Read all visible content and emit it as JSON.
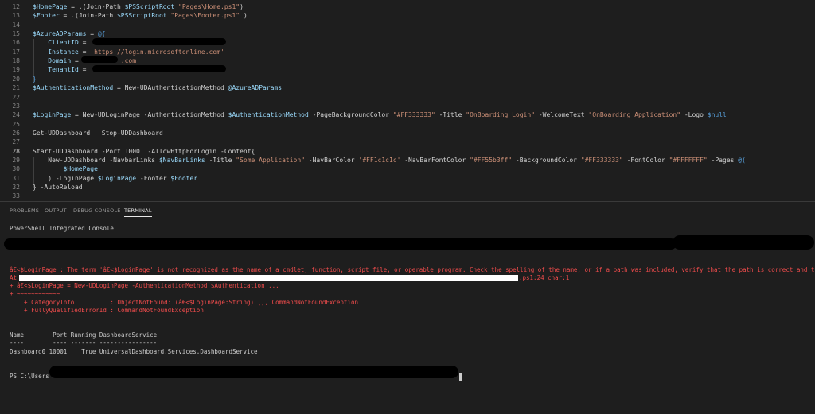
{
  "editor": {
    "lines": [
      {
        "n": "12",
        "parts": [
          [
            "v",
            "$HomePage"
          ],
          [
            "t",
            " = .(Join-Path "
          ],
          [
            "v",
            "$PSScriptRoot"
          ],
          [
            "t",
            " "
          ],
          [
            "s",
            "\"Pages\\Home.ps1\""
          ],
          [
            "t",
            ")"
          ]
        ]
      },
      {
        "n": "13",
        "parts": [
          [
            "v",
            "$Footer"
          ],
          [
            "t",
            " = .(Join-Path "
          ],
          [
            "v",
            "$PSScriptRoot"
          ],
          [
            "t",
            " "
          ],
          [
            "s",
            "\"Pages\\Footer.ps1\""
          ],
          [
            "t",
            " )"
          ]
        ]
      },
      {
        "n": "14",
        "parts": []
      },
      {
        "n": "15",
        "parts": [
          [
            "v",
            "$AzureADParams"
          ],
          [
            "t",
            " = "
          ],
          [
            "k",
            "@{"
          ]
        ]
      },
      {
        "n": "16",
        "parts": [
          [
            "t",
            "    "
          ],
          [
            "v",
            "ClientID"
          ],
          [
            "t",
            " = "
          ],
          [
            "s",
            "'"
          ]
        ]
      },
      {
        "n": "17",
        "parts": [
          [
            "t",
            "    "
          ],
          [
            "v",
            "Instance"
          ],
          [
            "t",
            " = "
          ],
          [
            "s",
            "'https://login.microsoftonline.com'"
          ]
        ]
      },
      {
        "n": "18",
        "parts": [
          [
            "t",
            "    "
          ],
          [
            "v",
            "Domain"
          ],
          [
            "t",
            " = "
          ],
          [
            "s",
            "'         .com'"
          ]
        ]
      },
      {
        "n": "19",
        "parts": [
          [
            "t",
            "    "
          ],
          [
            "v",
            "TenantId"
          ],
          [
            "t",
            " = "
          ],
          [
            "s",
            "'"
          ]
        ]
      },
      {
        "n": "20",
        "parts": [
          [
            "k",
            "}"
          ]
        ]
      },
      {
        "n": "21",
        "parts": [
          [
            "v",
            "$AuthenticationMethod"
          ],
          [
            "t",
            " = New-UDAuthenticationMethod "
          ],
          [
            "v",
            "@AzureADParams"
          ]
        ]
      },
      {
        "n": "22",
        "parts": []
      },
      {
        "n": "23",
        "parts": []
      },
      {
        "n": "24",
        "parts": [
          [
            "v",
            "$LoginPage"
          ],
          [
            "t",
            " = New-UDLoginPage -AuthenticationMethod "
          ],
          [
            "v",
            "$AuthenticationMethod"
          ],
          [
            "t",
            " -PageBackgroundColor "
          ],
          [
            "s",
            "\"#FF333333\""
          ],
          [
            "t",
            " -Title "
          ],
          [
            "s",
            "\"OnBoarding Login\""
          ],
          [
            "t",
            " -WelcomeText "
          ],
          [
            "s",
            "\"OnBoarding Application\""
          ],
          [
            "t",
            " -Logo "
          ],
          [
            "k",
            "$null"
          ]
        ]
      },
      {
        "n": "25",
        "parts": []
      },
      {
        "n": "26",
        "parts": [
          [
            "t",
            "Get-UDDashboard | Stop-UDDashboard"
          ]
        ]
      },
      {
        "n": "27",
        "parts": []
      },
      {
        "n": "28",
        "parts": [
          [
            "t",
            "Start-UDDashboard -Port 10001 -AllowHttpForLogin -Content{"
          ]
        ]
      },
      {
        "n": "29",
        "parts": [
          [
            "t",
            "    New-UDDashboard -NavbarLinks "
          ],
          [
            "v",
            "$NavBarLinks"
          ],
          [
            "t",
            " -Title "
          ],
          [
            "s",
            "\"Some Application\""
          ],
          [
            "t",
            " -NavBarColor "
          ],
          [
            "s",
            "'#FF1c1c1c'"
          ],
          [
            "t",
            " -NavBarFontColor "
          ],
          [
            "s",
            "\"#FF55b3ff\""
          ],
          [
            "t",
            " -BackgroundColor "
          ],
          [
            "s",
            "\"#FF333333\""
          ],
          [
            "t",
            " -FontColor "
          ],
          [
            "s",
            "\"#FFFFFFF\""
          ],
          [
            "t",
            " -Pages "
          ],
          [
            "k",
            "@("
          ]
        ]
      },
      {
        "n": "30",
        "parts": [
          [
            "t",
            "        "
          ],
          [
            "v",
            "$HomePage"
          ]
        ]
      },
      {
        "n": "31",
        "parts": [
          [
            "t",
            "    ) -LoginPage "
          ],
          [
            "v",
            "$LoginPage"
          ],
          [
            "t",
            " -Footer "
          ],
          [
            "v",
            "$Footer"
          ]
        ]
      },
      {
        "n": "32",
        "parts": [
          [
            "t",
            "} -AutoReload"
          ]
        ]
      },
      {
        "n": "33",
        "parts": []
      }
    ]
  },
  "panel": {
    "tabs": [
      "PROBLEMS",
      "OUTPUT",
      "DEBUG CONSOLE",
      "TERMINAL"
    ],
    "active_tab": "TERMINAL",
    "terminal": {
      "header": "PowerShell Integrated Console",
      "error_lines": [
        "â€<$LoginPage : The term 'â€<$LoginPage' is not recognized as the name of a cmdlet, function, script file, or operable program. Check the spelling of the name, or if a path was included, verify that the path is correct and try again.",
        "At",
        "+ â€<$LoginPage = New-UDLoginPage -AuthenticationMethod $Authentication ...",
        "+ ~~~~~~~~~~~~",
        "    + CategoryInfo          : ObjectNotFound: (â€<$LoginPage:String) [], CommandNotFoundException",
        "    + FullyQualifiedErrorId : CommandNotFoundException"
      ],
      "error_path_suffix": ".ps1:24 char:1",
      "table_header": "Name        Port Running DashboardService",
      "table_rule": "----        ---- ------- ----------------",
      "table_rows": [
        "Dashboard0 10001    True UniversalDashboard.Services.DashboardService"
      ],
      "prompt": "PS C:\\Users"
    }
  }
}
